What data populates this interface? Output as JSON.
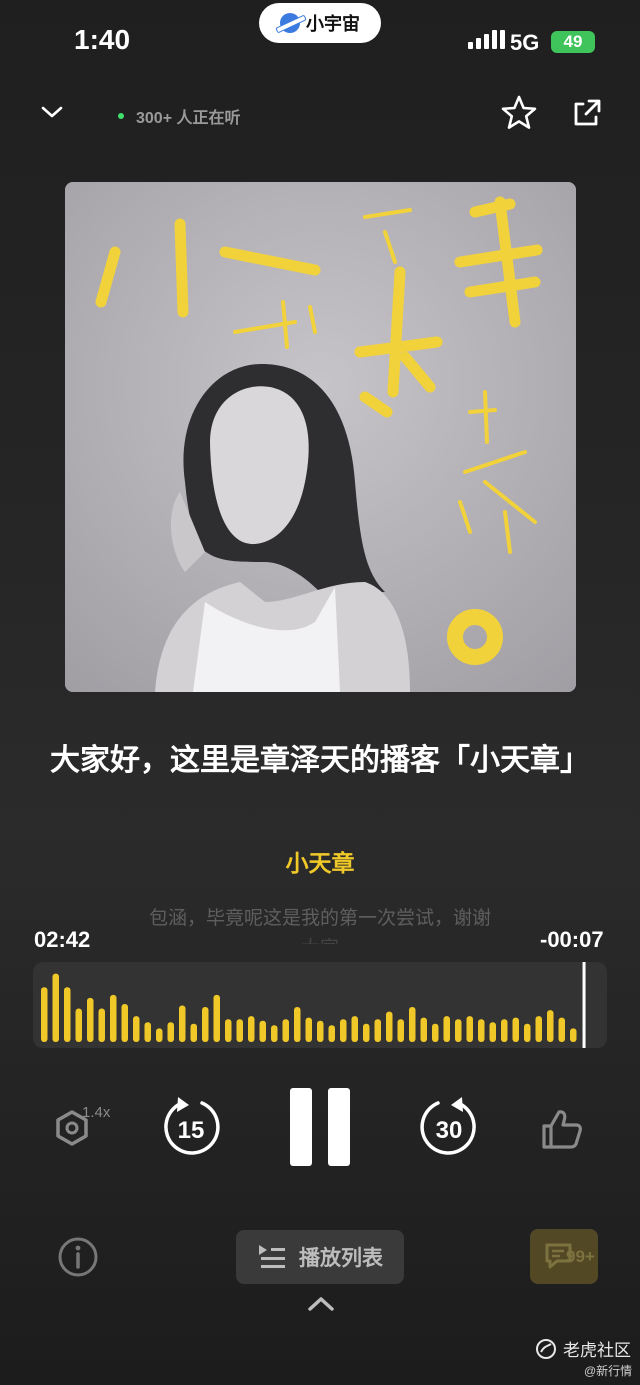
{
  "status_bar": {
    "time": "1:40",
    "network": "5G",
    "battery": "49"
  },
  "app_pill": {
    "label": "小宇宙"
  },
  "header": {
    "listeners": "300+ 人正在听"
  },
  "episode": {
    "title": "大家好，这里是章泽天的播客「小天章」",
    "author": "小天章",
    "lyric": "包涵，毕竟呢这是我的第一次尝试，谢谢",
    "lyric_next": "大家"
  },
  "progress": {
    "elapsed": "02:42",
    "remaining": "-00:07",
    "fraction": 0.96
  },
  "waveform": [
    0.72,
    0.9,
    0.72,
    0.44,
    0.58,
    0.44,
    0.62,
    0.5,
    0.34,
    0.26,
    0.18,
    0.26,
    0.48,
    0.24,
    0.46,
    0.62,
    0.3,
    0.3,
    0.34,
    0.28,
    0.22,
    0.3,
    0.46,
    0.32,
    0.28,
    0.22,
    0.3,
    0.34,
    0.24,
    0.3,
    0.4,
    0.3,
    0.46,
    0.32,
    0.24,
    0.34,
    0.3,
    0.34,
    0.3,
    0.26,
    0.3,
    0.32,
    0.24,
    0.34,
    0.42,
    0.32,
    0.18
  ],
  "controls": {
    "speed": "1.4x",
    "rewind": "15",
    "forward": "30"
  },
  "bottom": {
    "playlist_label": "播放列表",
    "comment_count": "99+"
  },
  "cover_art": {
    "text_big": "小天章"
  },
  "watermark": {
    "label": "老虎社区",
    "sub": "@新行情"
  },
  "colors": {
    "accent": "#f0c928",
    "background": "#262626",
    "live_dot": "#3ee06b"
  }
}
